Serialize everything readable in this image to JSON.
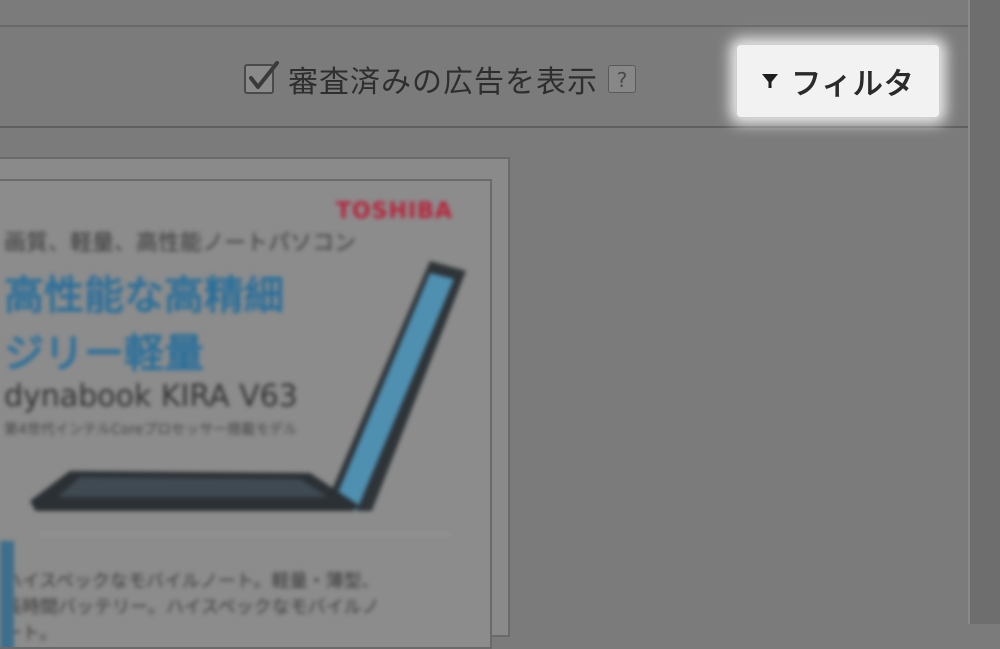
{
  "toolbar": {
    "approved_ads_label": "審査済みの広告を表示",
    "approved_ads_checked": true,
    "help_symbol": "?",
    "filter_label": "フィルタ",
    "filter_icon": "funnel-icon"
  },
  "ad_preview": {
    "brand": "TOSHIBA",
    "tagline": "画質、軽量、高性能ノートパソコン",
    "headline_1": "高性能な高精細",
    "headline_2": "ジリー軽量",
    "model": "dynabook KIRA V63",
    "spec_line": "第4世代インテルCoreプロセッサー搭載モデル",
    "body": "ハイスペックなモバイルノート。軽量・薄型、長時間バッテリー。ハイスペックなモバイルノート。"
  },
  "colors": {
    "overlay_gray": "#7b7b7b",
    "button_face": "#f2f2f2",
    "brand_red": "#b8233b",
    "headline_blue": "#2a6f9a"
  }
}
